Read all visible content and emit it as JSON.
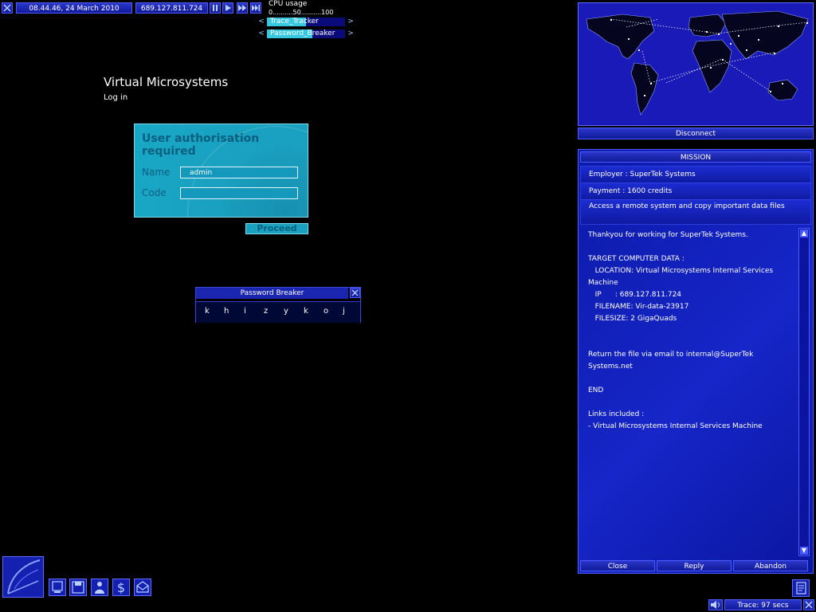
{
  "topbar": {
    "datetime": "08.44.46, 24 March 2010",
    "ip": "689.127.811.724",
    "cpu_label": "CPU usage",
    "cpu_scale": "0..........50..........100",
    "programs": [
      {
        "name": "Trace_Tracker",
        "progress": 0.5
      },
      {
        "name": "Password_Breaker",
        "progress": 0.58
      }
    ]
  },
  "site": {
    "title": "Virtual Microsystems",
    "subtitle": "Log in"
  },
  "auth": {
    "title": "User authorisation required",
    "name_label": "Name",
    "name_value": "admin",
    "code_label": "Code",
    "code_value": "",
    "proceed_label": "Proceed"
  },
  "password_breaker": {
    "title": "Password Breaker",
    "chars": [
      "k",
      "h",
      "i",
      "z",
      "y",
      "k",
      "o",
      "j"
    ]
  },
  "map": {
    "disconnect_label": "Disconnect"
  },
  "mission": {
    "header": "MISSION",
    "employer": "Employer : SuperTek Systems",
    "payment": "Payment : 1600 credits",
    "description": "Access a remote system and copy important data files",
    "body": "Thankyou for working for SuperTek Systems.\n\nTARGET COMPUTER DATA :\n   LOCATION: Virtual Microsystems Internal Services Machine\n   IP      : 689.127.811.724\n   FILENAME: Vir-data-23917\n   FILESIZE: 2 GigaQuads\n\n\nReturn the file via email to internal@SuperTek Systems.net\n\nEND\n\nLinks included :\n- Virtual Microsystems Internal Services Machine",
    "buttons": {
      "close": "Close",
      "reply": "Reply",
      "abandon": "Abandon"
    }
  },
  "trace": {
    "text": "Trace: 97 secs"
  },
  "colors": {
    "accent": "#1a25b0",
    "auth_bg": "#1aa0c0",
    "auth_text": "#0d5f80"
  }
}
